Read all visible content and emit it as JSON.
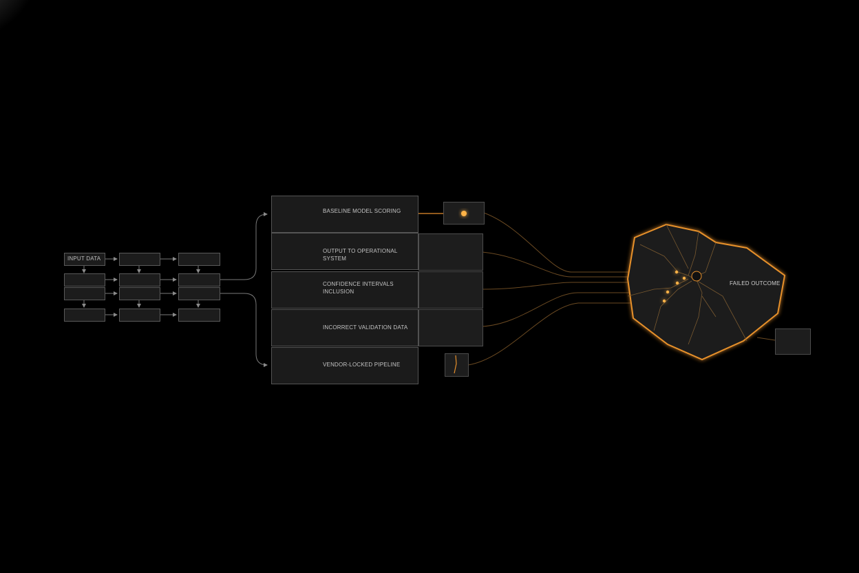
{
  "diagram": {
    "input_label": "INPUT DATA",
    "stages": [
      {
        "label": "BASELINE MODEL SCORING",
        "icon": "baseline-scoring-icon"
      },
      {
        "label": "OUTPUT TO OPERATIONAL SYSTEM",
        "icon": "arrow-in-box-icon"
      },
      {
        "label": "CONFIDENCE INTERVALS\nINCLUSION",
        "icon": "interval-arcs-icon"
      },
      {
        "label": "INCORRECT VALIDATION DATA",
        "icon": "broken-loop-icon"
      },
      {
        "label": "VENDOR-LOCKED PIPELINE",
        "icon": "locked-grid-icon"
      }
    ],
    "outcome_label": "FAILED OUTCOME",
    "colors": {
      "background": "#000000",
      "line": "#7a7a7a",
      "accent": "#e8912c",
      "accent_bright": "#ffb347",
      "panel": "#1c1c1c"
    }
  }
}
